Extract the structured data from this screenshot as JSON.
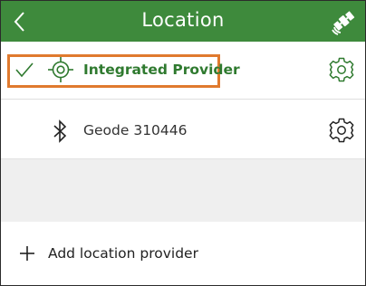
{
  "header": {
    "title": "Location",
    "back_icon": "chevron-left-icon",
    "satellite_icon": "satellite-icon",
    "background_color": "#3e8a3c"
  },
  "providers": [
    {
      "label": "Integrated Provider",
      "selected": true,
      "status_icon": "checkmark-icon",
      "icon": "target-crosshair-icon",
      "settings_icon": "gear-icon",
      "color": "#2f7a2f"
    },
    {
      "label": "Geode 310446",
      "selected": false,
      "icon": "bluetooth-icon",
      "settings_icon": "gear-icon"
    }
  ],
  "add_provider": {
    "label": "Add location provider",
    "icon": "plus-icon"
  },
  "highlight_color": "#e07a2e"
}
